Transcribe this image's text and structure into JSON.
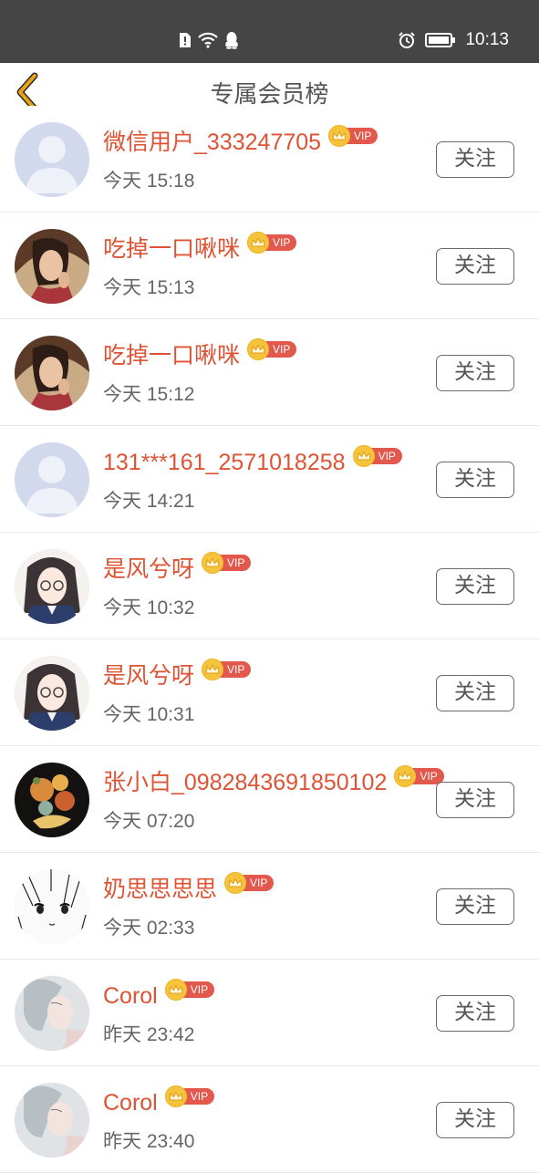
{
  "status_bar": {
    "time": "10:13",
    "icons": [
      "sim-alert-icon",
      "wifi-icon",
      "qq-penguin-icon",
      "alarm-icon",
      "battery-icon"
    ]
  },
  "header": {
    "title": "专属会员榜",
    "back_icon": "chevron-left-icon",
    "back_color": "#e8a21a"
  },
  "colors": {
    "name": "#de5333",
    "vip_tag": "#e2584d",
    "crown": "#f6c43c"
  },
  "vip_label": "VIP",
  "follow_label": "关注",
  "members": [
    {
      "name": "微信用户_333247705",
      "time": "今天 15:18",
      "avatar": "default-avatar"
    },
    {
      "name": "吃掉一口啾咪",
      "time": "今天 15:13",
      "avatar": "photo-avatar"
    },
    {
      "name": "吃掉一口啾咪",
      "time": "今天 15:12",
      "avatar": "photo-avatar"
    },
    {
      "name": "131***161_2571018258",
      "time": "今天 14:21",
      "avatar": "default-avatar"
    },
    {
      "name": "是风兮呀",
      "time": "今天 10:32",
      "avatar": "anime-avatar"
    },
    {
      "name": "是风兮呀",
      "time": "今天 10:31",
      "avatar": "anime-avatar"
    },
    {
      "name": "张小白_0982843691850102",
      "time": "今天 07:20",
      "avatar": "goldfish-avatar"
    },
    {
      "name": "奶思思思思",
      "time": "今天 02:33",
      "avatar": "sketch-avatar"
    },
    {
      "name": "Corol",
      "time": "昨天 23:42",
      "avatar": "portrait-avatar"
    },
    {
      "name": "Corol",
      "time": "昨天 23:40",
      "avatar": "portrait-avatar"
    }
  ]
}
